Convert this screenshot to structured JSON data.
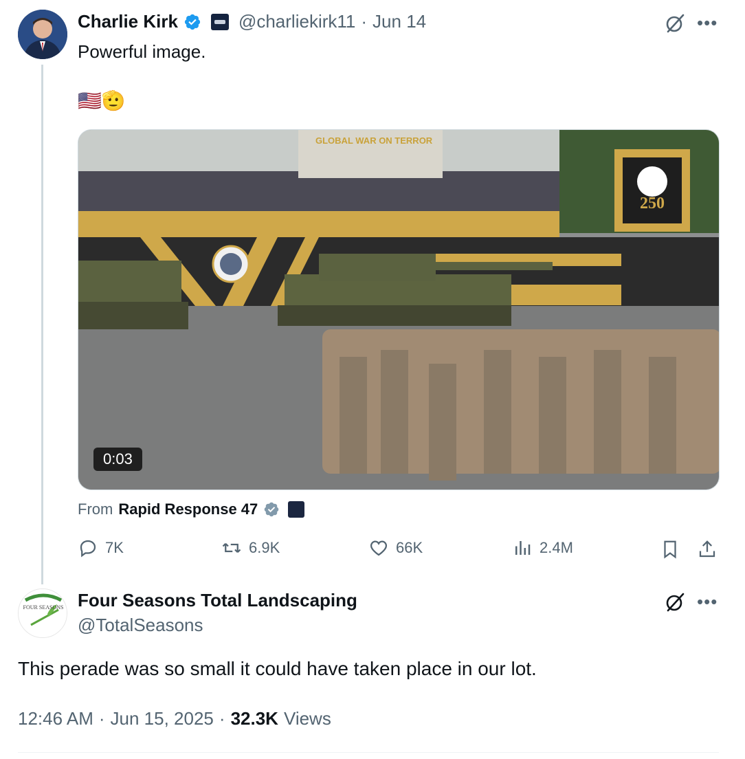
{
  "tweet": {
    "author_name": "Charlie Kirk",
    "author_handle": "@charliekirk11",
    "separator": "·",
    "date": "Jun 14",
    "text": "Powerful image.",
    "emoji": "🇺🇸🫡",
    "media": {
      "duration": "0:03",
      "banner_text": "GLOBAL WAR ON TERROR",
      "badge_text": "250"
    },
    "from_label": "From",
    "from_account": "Rapid Response 47",
    "stats": {
      "replies": "7K",
      "reposts": "6.9K",
      "likes": "66K",
      "views": "2.4M"
    }
  },
  "reply": {
    "author_name": "Four Seasons Total Landscaping",
    "author_handle": "@TotalSeasons",
    "avatar_text": "FOUR SEASONS",
    "text": "This perade was so small it could have taken place in our lot.",
    "time": "12:46 AM",
    "separator": "·",
    "date": "Jun 15, 2025",
    "views_count": "32.3K",
    "views_label": "Views"
  },
  "colors": {
    "verified_blue": "#1d9bf0",
    "secondary_text": "#536471",
    "line": "#cfd9de"
  },
  "icons": {
    "more": "more-icon",
    "grok": "grok-icon",
    "reply": "reply-icon",
    "repost": "repost-icon",
    "like": "like-icon",
    "views": "views-icon",
    "bookmark": "bookmark-icon",
    "share": "share-icon"
  }
}
